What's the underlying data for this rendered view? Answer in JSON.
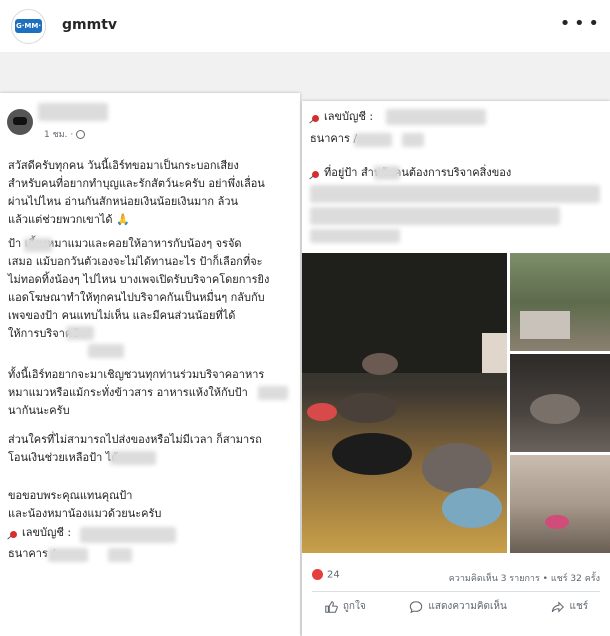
{
  "header": {
    "logo_text": "G·MM·",
    "username": "gmmtv",
    "more_icon": "more-horizontal-icon"
  },
  "left_post": {
    "time": "1 ชม. · ",
    "paragraphs": [
      "สวัสดีครับทุกคน วันนี้เอิร์ทขอมาเป็นกระบอกเสียง\nสำหรับคนที่อยากทำบุญและรักสัตว์นะครับ อย่าพึ่งเลื่อน\nผ่านไปไหน อ่านกันสักหน่อยเงินน้อยเงินมาก ล้วน\nแล้วแต่ช่วยพวกเขาได้ 🙏",
      "ป้า        เลี้ยงหมาแมวและคอยให้อาหารกับน้องๆ จรจัด\nเสมอ แม้บอกวันตัวเองจะไม่ได้ทานอะไร ป้าก็เลือกที่จะ\nไม่ทอดทิ้งน้องๆ ไปไหน บางเพจเปิดรับบริจาคโดยการยิง\nแอดโฆษณาทำให้ทุกคนไปบริจาคกันเป็นหมื่นๆ กลับกับ\nเพจของป้า        คนแทบไม่เห็น และมีคนส่วนน้อยที่ได้\nให้การบริจาคป้า",
      "ทั้งนี้เอิร์ทอยากจะมาเชิญชวนทุกท่านร่วมบริจาคอาหาร\nหมาแมวหรือแม้กระทั่งข้าวสาร อาหารแห้งให้กับป้า\nนากันนะครับ",
      "ส่วนใครที่ไม่สามารถไปส่งของหรือไม่มีเวลา ก็สามารถ\nโอนเงินช่วยเหลือป้า          ได้",
      "ขอขอบพระคุณแทนคุณป้า\nและน้องหมาน้องแมวด้วยนะครับ"
    ],
    "account_label": "เลขบัญชี : ",
    "bank_label": "ธนาคาร           /"
  },
  "right_post": {
    "account_label": "เลขบัญชี : ",
    "bank_label": "ธนาคาร          /",
    "address_label": "ที่อยู่ป้า          สำหรับคนต้องการบริจาคสิ่งของ",
    "reaction_count": "24",
    "stats": "ความคิดเห็น 3 รายการ • แชร์ 32 ครั้ง",
    "actions": {
      "like": "ถูกใจ",
      "comment": "แสดงความคิดเห็น",
      "share": "แชร์"
    }
  }
}
